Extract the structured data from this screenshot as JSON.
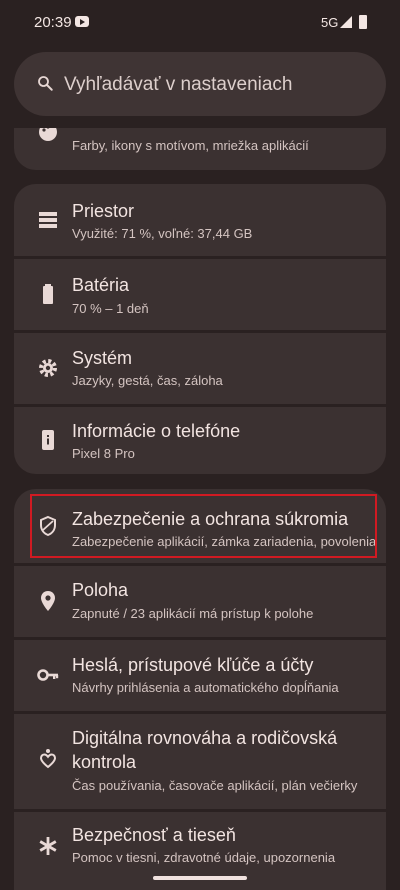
{
  "status_bar": {
    "time": "20:39",
    "network": "5G"
  },
  "search": {
    "placeholder": "Vyhľadávať v nastaveniach"
  },
  "rows": [
    {
      "sub": "Farby, ikony s motívom, mriežka aplikácií"
    },
    {
      "title": "Priestor",
      "sub": "Využité: 71 %, voľné: 37,44 GB"
    },
    {
      "title": "Batéria",
      "sub": "70 % – 1 deň"
    },
    {
      "title": "Systém",
      "sub": "Jazyky, gestá, čas, záloha"
    },
    {
      "title": "Informácie o telefóne",
      "sub": "Pixel 8 Pro"
    },
    {
      "title": "Zabezpečenie a ochrana súkromia",
      "sub": "Zabezpečenie aplikácií, zámka zariadenia, povolenia"
    },
    {
      "title": "Poloha",
      "sub": "Zapnuté / 23 aplikácií má prístup k polohe"
    },
    {
      "title": "Heslá, prístupové kľúče a účty",
      "sub": "Návrhy prihlásenia a automatického dopĺňania"
    },
    {
      "title_line1": "Digitálna rovnováha a rodičovská",
      "title_line2": "kontrola",
      "sub": "Čas používania, časovače aplikácií, plán večierky"
    },
    {
      "title": "Bezpečnosť a tieseň",
      "sub": "Pomoc v tiesni, zdravotné údaje, upozornenia"
    }
  ]
}
